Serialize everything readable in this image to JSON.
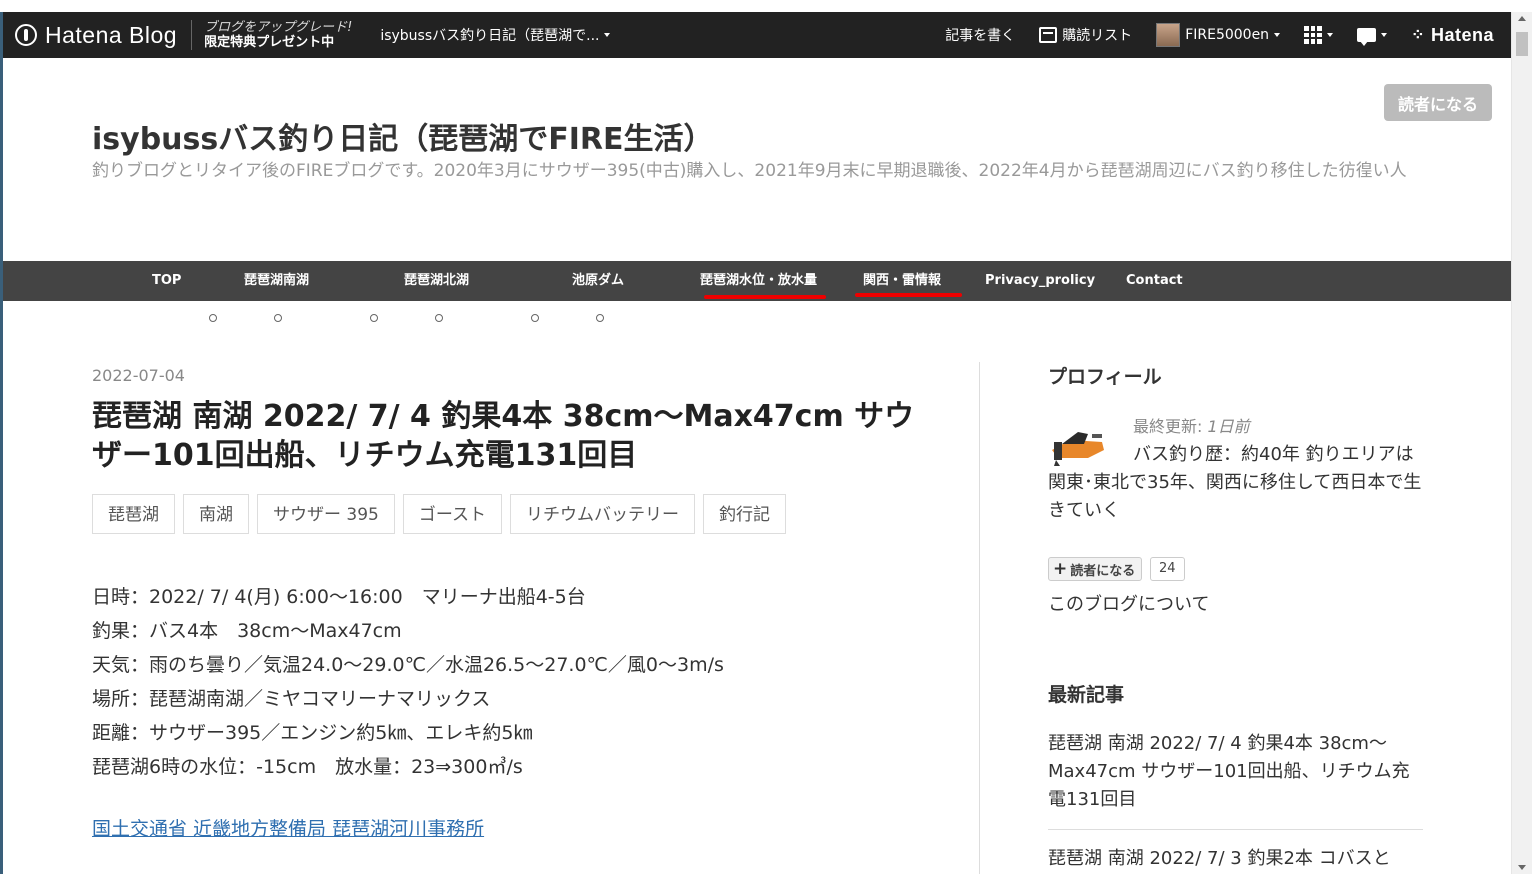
{
  "global_header": {
    "brand": "Hatena Blog",
    "upgrade_line1": "ブログをアップグレード!",
    "upgrade_line2": "限定特典プレゼント中",
    "blog_switcher": "isybussバス釣り日記（琵琶湖で...",
    "write": "記事を書く",
    "subscriptions": "購読リスト",
    "user": "FIRE5000en",
    "hatena": "Hatena"
  },
  "blog": {
    "title": "isybussバス釣り日記（琵琶湖でFIRE生活）",
    "description": "釣りブログとリタイア後のFIREブログです。2020年3月にサウザー395(中古)購入し、2021年9月末に早期退職後、2022年4月から琵琶湖周辺にバス釣り移住した彷徨い人",
    "reader_button": "読者になる"
  },
  "nav": {
    "items": [
      "TOP",
      "琵琶湖南湖",
      "琵琶湖北湖",
      "池原ダム",
      "琵琶湖水位・放水量",
      "関西・雷情報",
      "Privacy_prolicy",
      "Contact"
    ]
  },
  "entry": {
    "date": "2022-07-04",
    "title": "琵琶湖 南湖 2022/ 7/ 4 釣果4本 38cm〜Max47cm サウザー101回出船、リチウム充電131回目",
    "categories": [
      "琵琶湖",
      "南湖",
      "サウザー 395",
      "ゴースト",
      "リチウムバッテリー",
      "釣行記"
    ],
    "body": [
      "日時：2022/ 7/ 4(月) 6:00〜16:00　マリーナ出船4-5台",
      "釣果：バス4本　38cm〜Max47cm",
      "天気：雨のち曇り／気温24.0〜29.0℃／水温26.5〜27.0℃／風0〜3m/s",
      "場所：琵琶湖南湖／ミヤコマリーナマリックス",
      "距離：サウザー395／エンジン約5㎞、エレキ約5㎞",
      "琵琶湖6時の水位：-15cm　放水量：23⇒300㎥/s"
    ],
    "link": "国土交通省 近畿地方整備局 琵琶湖河川事務所"
  },
  "sidebar": {
    "profile_heading": "プロフィール",
    "updated_label": "最終更新: ",
    "updated_value": "1日前",
    "profile_text": "バス釣り歴：約40年 釣りエリアは関東･東北で35年、関西に移住して西日本で生きていく",
    "subscribe_label": "読者になる",
    "subscriber_count": "24",
    "about": "このブログについて",
    "recent_heading": "最新記事",
    "recent": [
      "琵琶湖 南湖 2022/ 7/ 4 釣果4本 38cm〜Max47cm サウザー101回出船、リチウム充電131回目",
      "琵琶湖 南湖 2022/ 7/ 3 釣果2本 コバスと"
    ]
  },
  "colors": {
    "header_bg": "#222222",
    "nav_bg": "#444444",
    "nav_highlight": "#e00000",
    "link": "#2f6fb0",
    "reader_button": "#bbbbbb"
  }
}
